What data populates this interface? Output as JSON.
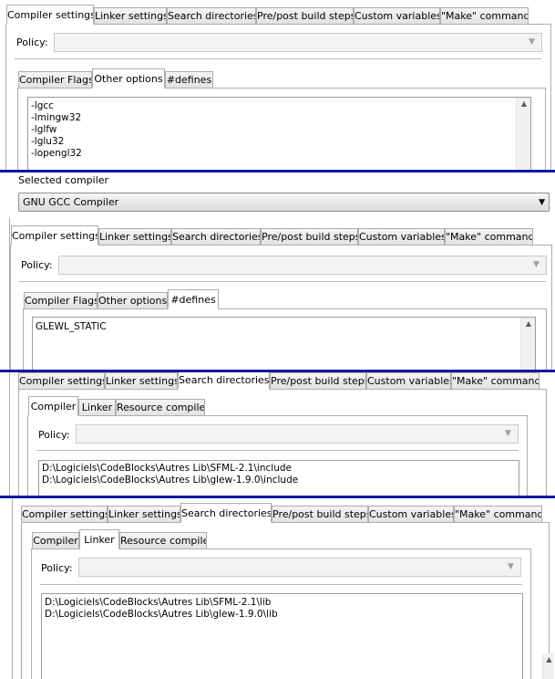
{
  "main_tabs": [
    "Compiler settings",
    "Linker settings",
    "Search directories",
    "Pre/post build steps",
    "Custom variables",
    "\"Make\" commands"
  ],
  "policy_label": "Policy:",
  "compiler_subtabs": [
    "Compiler Flags",
    "Other options",
    "#defines"
  ],
  "search_subtabs": [
    "Compiler",
    "Linker",
    "Resource compiler"
  ],
  "panel1": {
    "other_options": [
      "-lgcc",
      "-lmingw32",
      "-lglfw",
      "-lglu32",
      "-lopengl32"
    ]
  },
  "panel2": {
    "selected_compiler_label": "Selected compiler",
    "selected_compiler_value": "GNU GCC Compiler",
    "defines": [
      "GLEWL_STATIC"
    ]
  },
  "panel3": {
    "dirs": [
      "D:\\Logiciels\\CodeBlocks\\Autres Lib\\SFML-2.1\\include",
      "D:\\Logiciels\\CodeBlocks\\Autres Lib\\glew-1.9.0\\include"
    ]
  },
  "panel4": {
    "dirs": [
      "D:\\Logiciels\\CodeBlocks\\Autres Lib\\SFML-2.1\\lib",
      "D:\\Logiciels\\CodeBlocks\\Autres Lib\\glew-1.9.0\\lib"
    ]
  },
  "icons": {
    "combo_arrow": "chevron-down-icon",
    "scroll_up": "scroll-up-arrow-icon"
  },
  "colors": {
    "separator": "#0a1aa0",
    "tab_border": "#adadad"
  }
}
